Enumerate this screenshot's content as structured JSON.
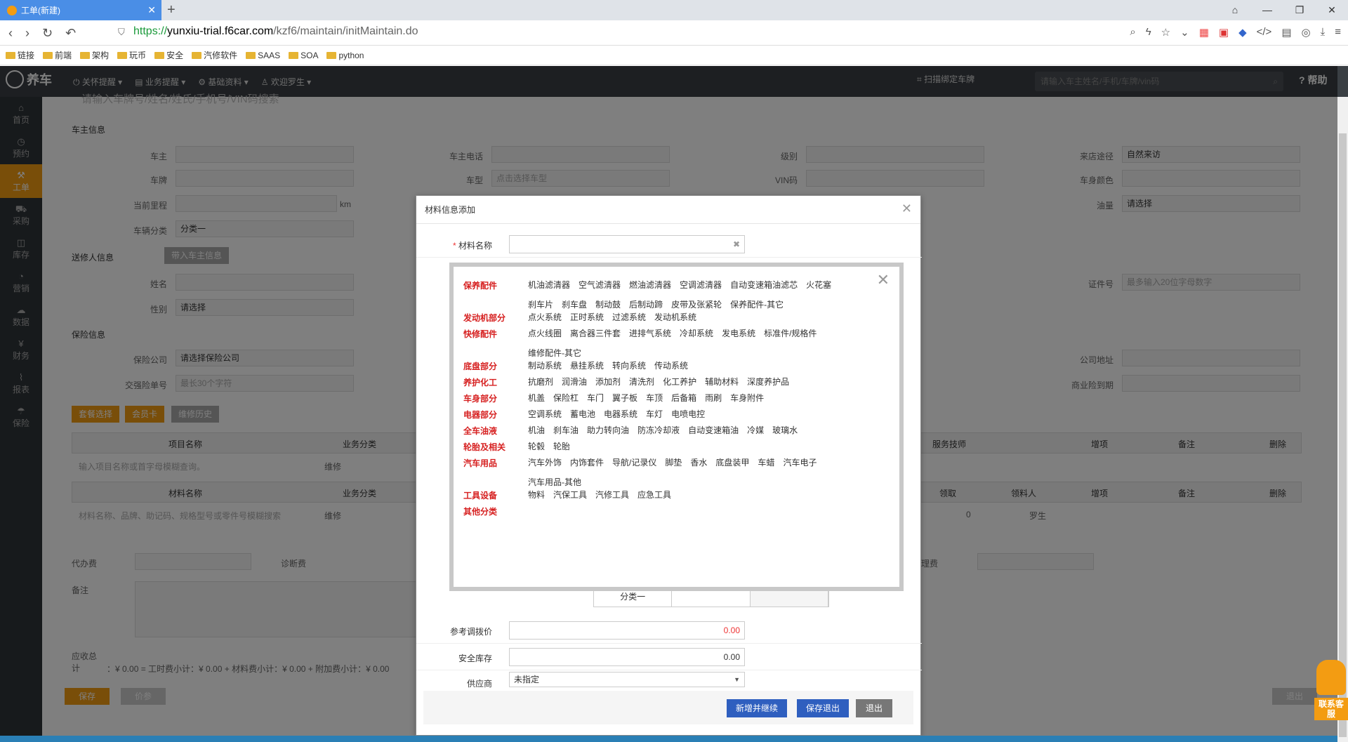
{
  "browser": {
    "tab_title": "工单(新建)",
    "url_scheme": "https://",
    "url_host": "yunxiu-trial.f6car.com",
    "url_path": "/kzf6/maintain/initMaintain.do",
    "bookmarks": [
      "链接",
      "前端",
      "架构",
      "玩币",
      "安全",
      "汽修软件",
      "SAAS",
      "SOA",
      "python"
    ]
  },
  "app": {
    "logo": "养车",
    "menus": [
      "关怀提醒",
      "业务提醒",
      "基础资料",
      "欢迎罗生"
    ],
    "scan_bind": "扫描绑定车牌",
    "search_placeholder": "请输入车主姓名/手机/车牌/vin码",
    "help": "帮助"
  },
  "sidebar": [
    "首页",
    "预约",
    "工单",
    "采购",
    "库存",
    "营销",
    "数据",
    "财务",
    "报表",
    "保险"
  ],
  "background": {
    "top_placeholder": "请输入车牌号/姓名/姓氏/手机号/VIN码搜索",
    "sec_owner": "车主信息",
    "owner_labels": [
      "车主",
      "车牌",
      "当前里程",
      "车辆分类",
      "车主电话",
      "车型",
      "VIN码",
      "级别",
      "来店途径",
      "车身颜色",
      "油量"
    ],
    "km": "km",
    "model_placeholder": "点击选择车型",
    "source_value": "自然来访",
    "fuel_value": "请选择",
    "vehicle_class_value": "分类一",
    "sec_sender": "送修人信息",
    "bring_owner_btn": "带入车主信息",
    "sender_labels": [
      "姓名",
      "性别",
      "证件号"
    ],
    "gender_value": "请选择",
    "cert_placeholder": "最多输入20位字母数字",
    "sec_insurance": "保险信息",
    "ins_labels": [
      "保险公司",
      "交强险单号",
      "公司地址",
      "商业险到期"
    ],
    "ins_company_value": "请选择保险公司",
    "ins_no_placeholder": "最长30个字符",
    "btn_package": "套餐选择",
    "btn_member": "会员卡",
    "btn_history": "维修历史",
    "item_headers": [
      "项目名称",
      "业务分类",
      "服务技师",
      "增项",
      "备注",
      "删除"
    ],
    "item_placeholder": "输入项目名称或首字母模糊查询。",
    "item_category": "维修",
    "mat_headers": [
      "材料名称",
      "业务分类",
      "领取",
      "领料人",
      "增项",
      "备注",
      "删除"
    ],
    "mat_placeholder": "材料名称、品牌、助记码、规格型号或零件号模糊搜索",
    "mat_category": "维修",
    "mat_qty": "0",
    "mat_person": "罗生",
    "agent_fee": "代办费",
    "diag_fee": "诊断费",
    "other_fee": "理费",
    "remark": "备注",
    "total_label": "应收总计",
    "total_value": "：¥ 0.00 = 工时费小计：¥ 0.00 + 材料费小计：¥ 0.00 + 附加费小计：¥ 0.00",
    "btn_save": "保存",
    "btn_price": "价参",
    "btn_exit": "退出"
  },
  "dialog": {
    "title": "材料信息添加",
    "material_name_label": "材料名称",
    "sub_table_cell": "分类一",
    "ref_price_label": "参考调拨价",
    "ref_price_value": "0.00",
    "safety_stock_label": "安全库存",
    "safety_stock_value": "0.00",
    "supplier_label": "供应商",
    "supplier_value": "未指定",
    "btn_add_continue": "新增并继续",
    "btn_save_exit": "保存退出",
    "btn_exit": "退出"
  },
  "categories": [
    {
      "name": "保养配件",
      "items": [
        "机油滤清器",
        "空气滤清器",
        "燃油滤清器",
        "空调滤清器",
        "自动变速箱油滤芯",
        "火花塞",
        "刹车片",
        "刹车盘",
        "制动鼓",
        "后制动蹄",
        "皮带及张紧轮",
        "保养配件-其它"
      ]
    },
    {
      "name": "发动机部分",
      "items": [
        "点火系统",
        "正时系统",
        "过滤系统",
        "发动机系统"
      ]
    },
    {
      "name": "快修配件",
      "items": [
        "点火线圈",
        "离合器三件套",
        "进排气系统",
        "冷却系统",
        "发电系统",
        "标准件/规格件",
        "维修配件-其它"
      ]
    },
    {
      "name": "底盘部分",
      "items": [
        "制动系统",
        "悬挂系统",
        "转向系统",
        "传动系统"
      ]
    },
    {
      "name": "养护化工",
      "items": [
        "抗磨剂",
        "润滑油",
        "添加剂",
        "清洗剂",
        "化工养护",
        "辅助材料",
        "深度养护品"
      ]
    },
    {
      "name": "车身部分",
      "items": [
        "机盖",
        "保险杠",
        "车门",
        "翼子板",
        "车顶",
        "后备箱",
        "雨刷",
        "车身附件"
      ]
    },
    {
      "name": "电器部分",
      "items": [
        "空调系统",
        "蓄电池",
        "电器系统",
        "车灯",
        "电喷电控"
      ]
    },
    {
      "name": "全车油液",
      "items": [
        "机油",
        "刹车油",
        "助力转向油",
        "防冻冷却液",
        "自动变速箱油",
        "冷媒",
        "玻璃水"
      ]
    },
    {
      "name": "轮胎及相关",
      "items": [
        "轮毂",
        "轮胎"
      ]
    },
    {
      "name": "汽车用品",
      "items": [
        "汽车外饰",
        "内饰套件",
        "导航/记录仪",
        "脚垫",
        "香水",
        "底盘装甲",
        "车蜡",
        "汽车电子",
        "汽车用品-其他"
      ]
    },
    {
      "name": "工具设备",
      "items": [
        "物料",
        "汽保工具",
        "汽修工具",
        "应急工具"
      ]
    },
    {
      "name": "其他分类",
      "items": []
    }
  ],
  "bot_label": "联系客服"
}
